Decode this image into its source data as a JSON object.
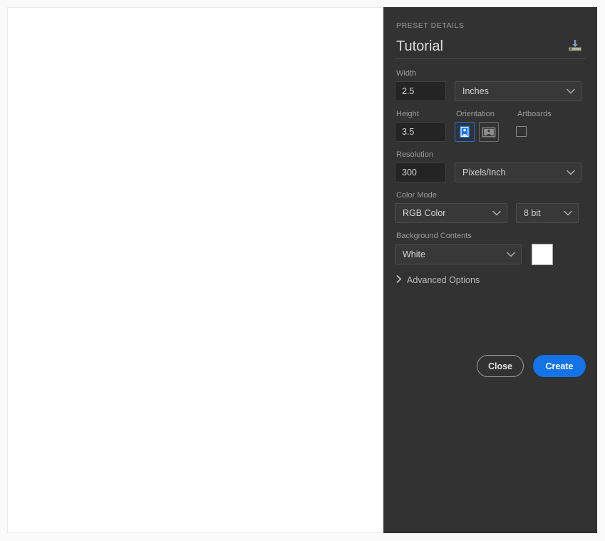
{
  "panel": {
    "heading": "PRESET DETAILS",
    "preset_name": "Tutorial",
    "save_preset_icon": "save-preset-download-icon",
    "accent_color": "#1473E6",
    "panel_bg": "#323232"
  },
  "fields": {
    "width": {
      "label": "Width",
      "value": "2.5",
      "units_selected": "Inches",
      "units_icon": "chevron-down-icon"
    },
    "height": {
      "label": "Height",
      "value": "3.5"
    },
    "orientation": {
      "label": "Orientation",
      "portrait_icon": "portrait-orientation-icon",
      "landscape_icon": "landscape-orientation-icon",
      "selected": "portrait"
    },
    "artboards": {
      "label": "Artboards",
      "checked": false
    },
    "resolution": {
      "label": "Resolution",
      "value": "300",
      "units_selected": "Pixels/Inch"
    },
    "color_mode": {
      "label": "Color Mode",
      "value": "RGB Color",
      "depth": "8 bit"
    },
    "background_contents": {
      "label": "Background Contents",
      "value": "White",
      "swatch_color": "#FFFFFF"
    },
    "advanced_options": {
      "label": "Advanced Options",
      "expanded": false,
      "icon": "chevron-right-icon"
    }
  },
  "actions": {
    "close_label": "Close",
    "create_label": "Create"
  }
}
